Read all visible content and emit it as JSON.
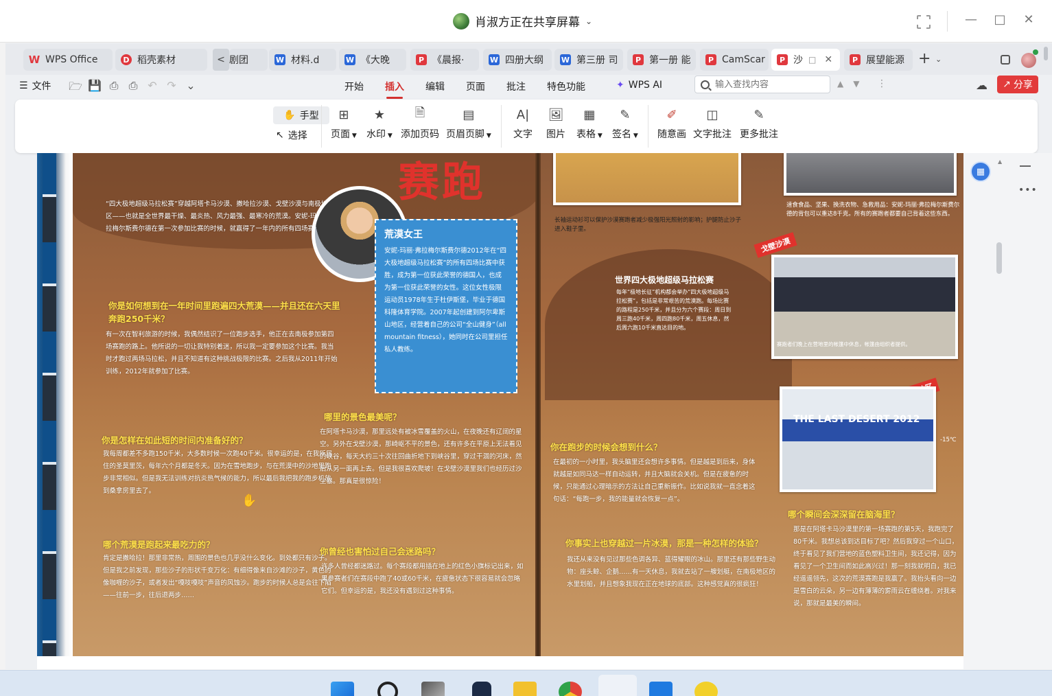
{
  "share_bar": {
    "title": "肖淑方正在共享屏幕"
  },
  "tabs": [
    {
      "label": "WPS Office",
      "icon": "wps-logo-icon",
      "type": "wps"
    },
    {
      "label": "稻壳素材",
      "icon": "docer-icon",
      "type": "d"
    },
    {
      "label": "剧团",
      "icon": "",
      "type": "none"
    },
    {
      "label": "材料.d",
      "icon": "word-icon",
      "type": "w"
    },
    {
      "label": "《大晚",
      "icon": "word-icon",
      "type": "w"
    },
    {
      "label": "《晨报·",
      "icon": "pdf-icon",
      "type": "p"
    },
    {
      "label": "四册大纲",
      "icon": "word-icon",
      "type": "w"
    },
    {
      "label": "第三册 司",
      "icon": "word-icon",
      "type": "w"
    },
    {
      "label": "第一册 能",
      "icon": "pdf-icon",
      "type": "p"
    },
    {
      "label": "CamScar",
      "icon": "pdf-icon",
      "type": "p"
    },
    {
      "label": "沙",
      "icon": "pdf-icon",
      "type": "p",
      "active": true
    },
    {
      "label": "展望能源",
      "icon": "pdf-icon",
      "type": "p"
    }
  ],
  "menu": {
    "file_label": "文件",
    "tabs": [
      "开始",
      "插入",
      "编辑",
      "页面",
      "批注",
      "特色功能"
    ],
    "active_tab": "插入",
    "wps_ai_label": "WPS AI",
    "search_placeholder": "输入查找内容",
    "share_label": "分享"
  },
  "ribbon": {
    "hand_label": "手型",
    "select_label": "选择",
    "buttons": [
      {
        "label": "页面",
        "dropdown": true,
        "icon": "page-add-icon"
      },
      {
        "label": "水印",
        "dropdown": true,
        "icon": "watermark-icon"
      },
      {
        "label": "添加页码",
        "dropdown": false,
        "icon": "page-number-icon"
      },
      {
        "label": "页眉页脚",
        "dropdown": true,
        "icon": "header-footer-icon"
      },
      {
        "label": "文字",
        "dropdown": false,
        "icon": "text-icon"
      },
      {
        "label": "图片",
        "dropdown": false,
        "icon": "image-icon"
      },
      {
        "label": "表格",
        "dropdown": true,
        "icon": "table-icon"
      },
      {
        "label": "签名",
        "dropdown": true,
        "icon": "signature-icon"
      },
      {
        "label": "随意画",
        "dropdown": false,
        "icon": "freehand-draw-icon"
      },
      {
        "label": "文字批注",
        "dropdown": false,
        "icon": "text-comment-icon"
      },
      {
        "label": "更多批注",
        "dropdown": false,
        "icon": "more-comments-icon"
      }
    ]
  },
  "document": {
    "page_title": "赛跑",
    "intro": "“四大极地超级马拉松赛”穿越阿塔卡马沙漠、撒哈拉沙漠、戈壁沙漠与南极地区——也就是全世界最干燥、最炎热、风力最强、最寒冷的荒漠。安妮-玛丽·弗拉梅尔斯费尔德在第一次参加比赛的时候，就赢得了一年内的所有四场赛跑。",
    "sidebar_title": "荒漠女王",
    "sidebar_text": "安妮-玛丽·弗拉梅尔斯费尔德2012年在“四大极地超级马拉松赛”的所有四场比赛中获胜，成为第一位获此荣誉的德国人，也成为第一位获此荣誉的女性。这位女性极限运动员1978年生于杜伊斯堡，毕业于德国科隆体育学院。2007年起创建到阿尔卑斯山地区，经营着自己的公司“全山健身”（all mountain fitness），她同时在公司里担任私人教练。",
    "q1": "你是如何想到在一年时间里跑遍四大荒漠——并且还在六天里奔跑250千米？",
    "a1": "有一次在智利旅游的时候，我偶然结识了一位跑步选手，他正在去南极参加第四场赛跑的路上。他所说的一切让我特别着迷，所以我一定要参加这个比赛。我当时才跑过两场马拉松，并且不知道有这种挑战极限的比赛。之后我从2011年开始训练，2012年就参加了比赛。",
    "q2": "你是怎样在如此短的时间内准备好的？",
    "a2": "我每周都差不多跑150千米，大多数时候一次跑40千米。很幸运的是，在我所居住的圣莫里茨，每年六个月都是冬天。因为在雪地跑步，与在荒漠中的沙地里跑步非常相似。但是我无法训练对抗炎热气候的能力，所以最后我把我的跑步机放到桑拿房里去了。",
    "q3": "哪个荒漠是跑起来最吃力的？",
    "a3": "肯定是撒哈拉！那里非常热，周围的景色也几乎没什么变化。到处都只有沙子。但是我之前发现，那些沙子的形状千变万化：有细得像来自沙滩的沙子，黄色的像咖喱的沙子，或者发出“嘎吱嘎吱”声音的风蚀沙。跑步的时候人总是会往下陷——往前一步，往后退两步……",
    "q4": "哪里的景色最美呢？",
    "a4": "在阿塔卡马沙漠，那里远处有被冰雪覆盖的火山，在夜晚还有辽阔的星空。另外在戈壁沙漠，那崎岖不平的景色，还有许多在平原上无法看见的峡谷，每天大约三十次往回曲折地下到峡谷里，穿过干涸的河床，然后从另一面再上去。但是我很喜欢爬坡！在戈壁沙漠里我们也经历过沙尘暴。那真是很惊险！",
    "q5": "你曾经也害怕过自己会迷路吗？",
    "a5": "许多人曾经都迷路过。每个赛段都用插在地上的红色小旗标记出来，如果参赛者们在赛段中跑了40或60千米，在疲惫状态下很容易就会忽略它们。但幸运的是，我还没有遇到过这种事情。",
    "caption_top": "长袖运动衫可以保护沙漠赛跑者减少极强阳光照射的影响；护腿防止沙子进入鞋子里。",
    "box_title": "世界四大极地超级马拉松赛",
    "box_text": "每年“极地长征”机构都会举办“四大极地超级马拉松赛”，包括是非常艰苦的荒漠跑。每场比赛的路程是250千米，并且分为六个赛段：周日到周三跑40千米，周四跑80千米，周五休息，然后周六跑10千米直达目的地。",
    "caption_right_top": "速食食品、坚果、换洗衣物、急救用品：安妮-玛丽·弗拉梅尔斯费尔德的背包可以重达8千克。所有的赛跑者都要自己背着这些东西。",
    "tag_gobi": "戈壁沙漠",
    "caption_camp": "赛跑者们晚上在营地里的帐篷中休息，帐篷由组织者提供。",
    "tag_antarctica": "南极地区",
    "banner_text": "THE LAST DESERT 2012",
    "temp_text": "-15℃",
    "q6": "你在跑步的时候会想到什么？",
    "a6": "在最初的一小时里，我头脑里还会想许多事情。但是越是到后来，身体就越是如同马达一样自动运转，并且大脑就会关机。但是在疲惫的时候，只能通过心理暗示的方法让自己重新振作。比如说我就一直念着这句话：“每跑一步，我的能量就会恢复一点”。",
    "q7": "你事实上也穿越过一片冰漠，那是一种怎样的体验？",
    "a7": "我还从来没有见过那些色调各异、蓝得耀眼的冰山。那里还有那些野生动物：座头鲸、企鹅……有一天休息，我就去站了一艘划艇，在南极地区的水里划船，并且想象我现在正在地球的底部。这种感觉真的很疯狂！",
    "q8": "哪个瞬间会深深留在脑海里？",
    "a8": "那是在阿塔卡马沙漠里的第一场赛跑的第5天，我跑完了80千米。我想总该到达目标了吧？然后我穿过一个山口，终于看见了我们营地的蓝色塑料卫生间，我还记得，因为看见了一个卫生间而如此高兴过！那一刻我就明白，我已经遥遥领先，这次的荒漠赛跑是我赢了。我抬头看向一边是雪白的云朵，另一边有薄薄的雾雨云在缠绕着。对我来说，那就是最美的瞬间。"
  },
  "colors": {
    "accent_red": "#e23b3b",
    "active_tab_red": "#d3312f",
    "word_blue": "#2b67d8",
    "sidebar_blue": "#3a8fd2",
    "title_red": "#e0322c",
    "question_yellow": "#ffe04a"
  }
}
